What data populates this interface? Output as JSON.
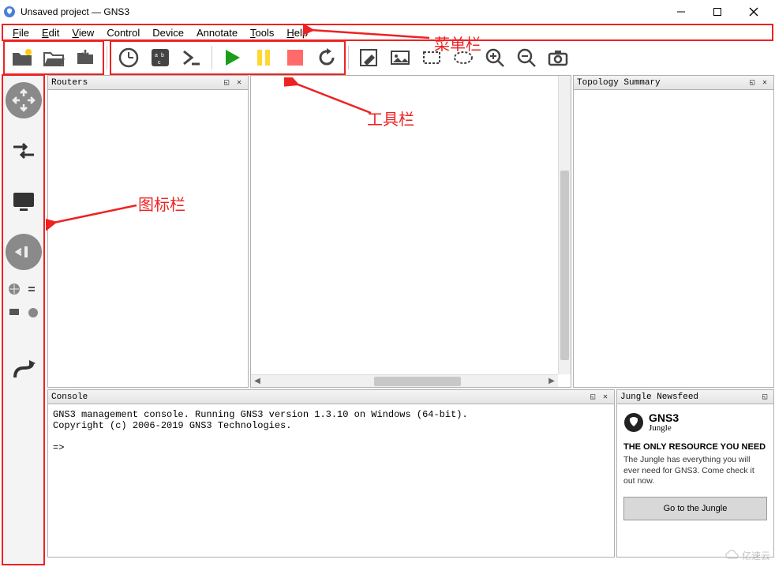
{
  "window": {
    "title": "Unsaved project — GNS3"
  },
  "menu": {
    "file": "File",
    "edit": "Edit",
    "view": "View",
    "control": "Control",
    "device": "Device",
    "annotate": "Annotate",
    "tools": "Tools",
    "help": "Help"
  },
  "toolbar_icons": {
    "new": "new-project-icon",
    "open": "open-project-icon",
    "save": "save-project-icon",
    "clock": "clock-icon",
    "device": "device-config-icon",
    "console": "console-icon",
    "play": "play-icon",
    "pause": "pause-icon",
    "stop": "stop-icon",
    "reload": "reload-icon",
    "note": "add-note-icon",
    "image": "insert-image-icon",
    "rect": "draw-rectangle-icon",
    "ellipse": "draw-ellipse-icon",
    "zoomin": "zoom-in-icon",
    "zoomout": "zoom-out-icon",
    "screenshot": "screenshot-icon"
  },
  "panels": {
    "routers": "Routers",
    "topology": "Topology Summary",
    "console": "Console",
    "newsfeed": "Jungle Newsfeed"
  },
  "console_text": "GNS3 management console. Running GNS3 version 1.3.10 on Windows (64-bit).\nCopyright (c) 2006-2019 GNS3 Technologies.\n\n=>",
  "newsfeed": {
    "brand": "GNS3",
    "brand_sub": "Jungle",
    "headline": "THE ONLY RESOURCE YOU NEED",
    "desc": "The Jungle has everything you will ever need for GNS3. Come check it out now.",
    "cta": "Go to the Jungle"
  },
  "annotations": {
    "menubar": "菜单栏",
    "toolbar": "工具栏",
    "iconbar": "图标栏"
  },
  "watermark": "亿速云"
}
